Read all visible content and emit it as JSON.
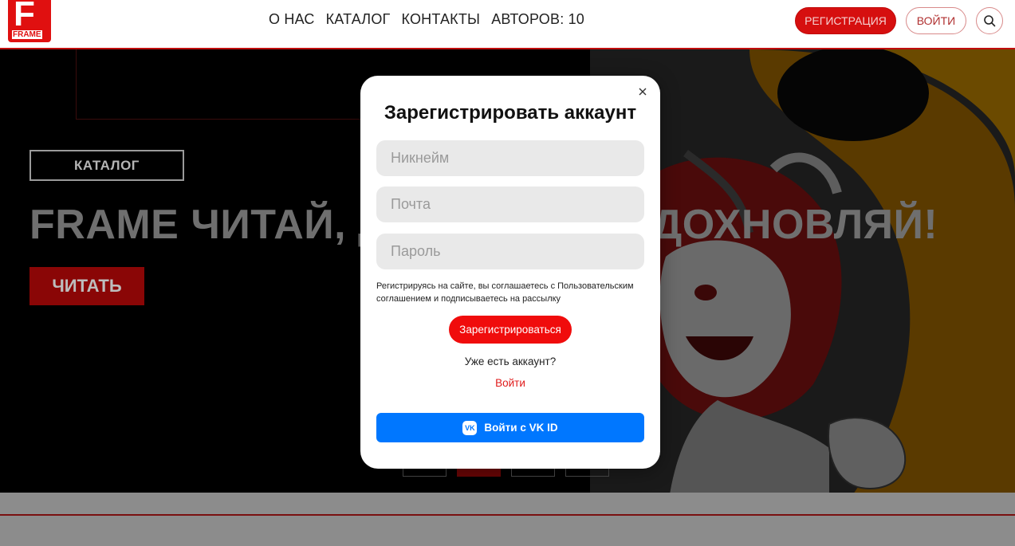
{
  "header": {
    "logo_letter": "F",
    "logo_text": "FRAME",
    "nav": [
      {
        "label": "О НАС"
      },
      {
        "label": "КАТАЛОГ"
      },
      {
        "label": "КОНТАКТЫ"
      },
      {
        "label": "АВТОРОВ: 10"
      }
    ],
    "register_label": "РЕГИСТРАЦИЯ",
    "login_label": "ВОЙТИ",
    "search_icon": "search-icon"
  },
  "hero": {
    "tag": "КАТАЛОГ",
    "headline": "FRAME ЧИТАЙ, ДОБАВЛЯЙ, ВДОХНОВЛЯЙ!",
    "read_button": "ЧИТАТЬ",
    "slides": 4,
    "active_slide": 2
  },
  "modal": {
    "close_icon": "close-icon",
    "title": "Зарегистрировать аккаунт",
    "nickname_placeholder": "Никнейм",
    "email_placeholder": "Почта",
    "password_placeholder": "Пароль",
    "agreement": "Регистрируясь на сайте, вы соглашаетесь с Пользовательским соглашением и подписываетесь на рассылку",
    "submit_label": "Зарегистрироваться",
    "have_account": "Уже есть аккаунт?",
    "login_link": "Войти",
    "vk_label": "Войти с VK ID",
    "vk_icon": "vk-logo-icon"
  },
  "colors": {
    "brand_red": "#e01010",
    "vk_blue": "#0077ff",
    "field_bg": "#e9e9e9"
  }
}
